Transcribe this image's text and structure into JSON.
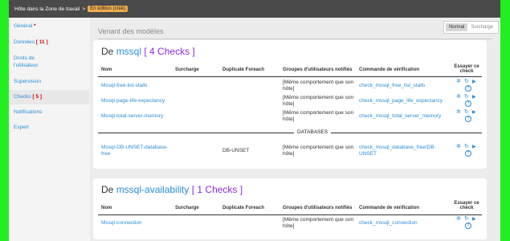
{
  "topbar": {
    "path": "Hôte dans la Zone de travail",
    "sep": ">",
    "badge": "En édition (créé)"
  },
  "sidebar": {
    "items": [
      {
        "label": "Général",
        "mark": "*"
      },
      {
        "label": "Données",
        "count": "[ 11 ]"
      },
      {
        "label": "Droits de l'utilisateur"
      },
      {
        "label": "Supervision"
      },
      {
        "label": "Checks",
        "count": "[ 5 ]"
      },
      {
        "label": "Notifications"
      },
      {
        "label": "Expert"
      }
    ]
  },
  "modes": {
    "normal": "Normal",
    "override": "Surcharge"
  },
  "from_label": "Venant des modèles",
  "columns": {
    "name": "Nom",
    "override": "Surcharge",
    "foreach": "Duplicate Foreach",
    "groups": "Groupes d'utilisateurs notifiés",
    "command": "Commande de vérification",
    "try": "Essayer ce check"
  },
  "card1": {
    "prefix": "De",
    "template": "mssql",
    "count": "[ 4 Checks ]",
    "rows": [
      {
        "name": "Mssql-free-list-stalls",
        "groups": "[Même comportement que son hôte]",
        "command": "check_mssql_free_list_stalls"
      },
      {
        "name": "Mssql-page-life-expectancy",
        "groups": "[Même comportement que son hôte]",
        "command": "check_mssql_page_life_expectancy"
      },
      {
        "name": "Mssql-total-server-memory",
        "groups": "[Même comportement que son hôte]",
        "command": "check_mssql_total_server_memory"
      }
    ],
    "separator": "DATABASES",
    "db_row": {
      "name": "Mssql-DB-UNSET-database-free",
      "foreach": "DB-UNSET",
      "groups": "[Même comportement que son hôte]",
      "command": "check_mssql_database_free!DB-UNSET"
    }
  },
  "card2": {
    "prefix": "De",
    "template": "mssql-availability",
    "count": "[ 1 Checks ]",
    "rows": [
      {
        "name": "Mssql-connection",
        "groups": "[Même comportement que son hôte]",
        "command": "check_mssql_connection"
      }
    ]
  },
  "icons": {
    "config": "gear-icon",
    "refresh": "refresh-icon",
    "play": "play-icon",
    "help": "help-icon"
  }
}
